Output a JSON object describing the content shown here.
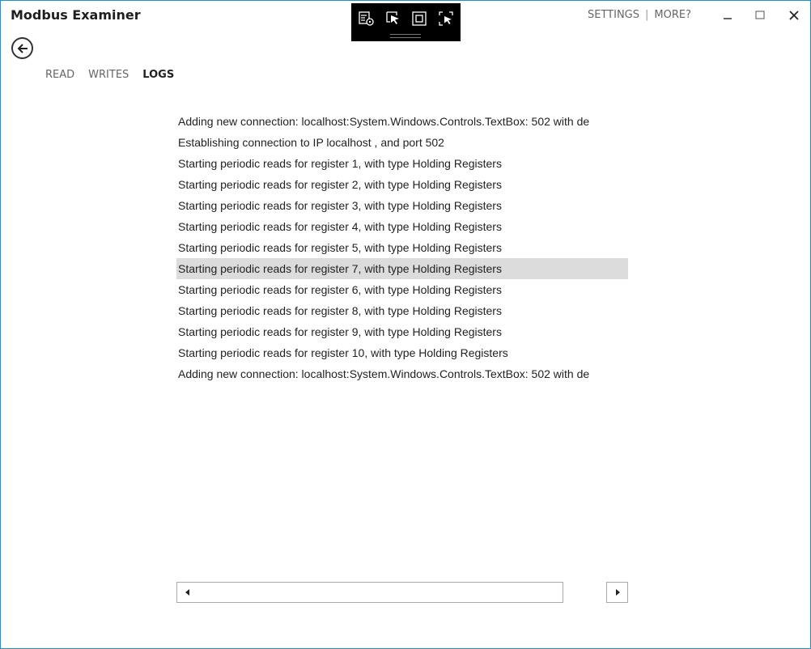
{
  "app": {
    "title": "Modbus Examiner"
  },
  "dev_toolbar": {
    "icons": [
      "live-visual-tree-icon",
      "select-element-icon",
      "display-adorners-icon",
      "track-focus-icon"
    ]
  },
  "header": {
    "settings_label": "SETTINGS",
    "separator": "|",
    "more_label": "MORE?"
  },
  "window_controls": {
    "icons": [
      "minimize-icon",
      "maximize-icon",
      "close-icon"
    ]
  },
  "nav": {
    "back_icon": "arrow-left-icon",
    "tabs": [
      {
        "label": "READ",
        "active": false
      },
      {
        "label": "WRITES",
        "active": false
      },
      {
        "label": "LOGS",
        "active": true
      }
    ]
  },
  "logs": {
    "selected_index": 7,
    "lines": [
      "Adding new connection: localhost:System.Windows.Controls.TextBox: 502 with de",
      "Establishing connection to IP localhost , and port 502",
      "Starting periodic reads for register 1, with type Holding Registers",
      "Starting periodic reads for register 2, with type Holding Registers",
      "Starting periodic reads for register 3, with type Holding Registers",
      "Starting periodic reads for register 4, with type Holding Registers",
      "Starting periodic reads for register 5, with type Holding Registers",
      "Starting periodic reads for register 7, with type Holding Registers",
      "Starting periodic reads for register 6, with type Holding Registers",
      "Starting periodic reads for register 8, with type Holding Registers",
      "Starting periodic reads for register 9, with type Holding Registers",
      "Starting periodic reads for register 10, with type Holding Registers",
      "Adding new connection: localhost:System.Windows.Controls.TextBox: 502 with de"
    ]
  },
  "scrollbar": {
    "left_icon": "scroll-left-icon",
    "right_icon": "scroll-right-icon"
  },
  "colors": {
    "window_border": "#1e90d6",
    "selected_row": "#dcdcdc",
    "toolbar_bg": "#000000"
  }
}
